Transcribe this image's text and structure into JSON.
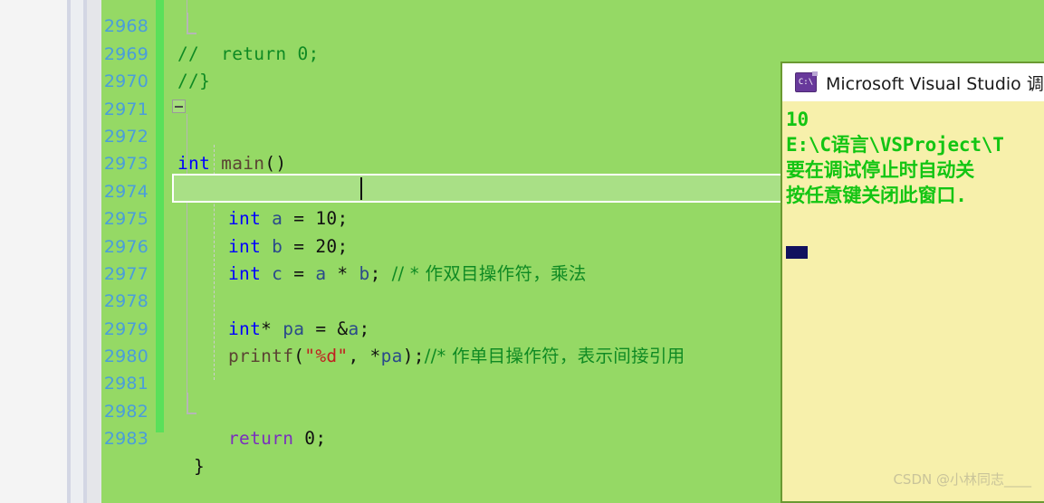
{
  "app": {
    "kind": "visual-studio-code-editor-with-debug-console"
  },
  "editor": {
    "background_color": "#95d965",
    "line_number_color": "#4a9ddb",
    "change_bar_color": "#5ae05a",
    "current_line": 2975,
    "lines": [
      {
        "number": "2968",
        "text": "//  return 0;"
      },
      {
        "number": "2969",
        "text": "//}"
      },
      {
        "number": "2970",
        "text": ""
      },
      {
        "number": "2971",
        "text": ""
      },
      {
        "number": "2972",
        "text": "int main()"
      },
      {
        "number": "2973",
        "text": "{"
      },
      {
        "number": "2974",
        "text": "    int a = 10;"
      },
      {
        "number": "2975",
        "text": "    int b = 20;"
      },
      {
        "number": "2976",
        "text": "    int c = a * b; // * 作双目操作符，乘法"
      },
      {
        "number": "2977",
        "text": ""
      },
      {
        "number": "2978",
        "text": "    int* pa = &a;"
      },
      {
        "number": "2979",
        "text": "    printf(\"%d\", *pa);//* 作单目操作符，表示间接引用"
      },
      {
        "number": "2980",
        "text": ""
      },
      {
        "number": "2981",
        "text": ""
      },
      {
        "number": "2982",
        "text": "    return 0;"
      },
      {
        "number": "2983",
        "text": "}"
      }
    ],
    "tokens": {
      "kw_int": "int",
      "kw_return": "return",
      "fn_main": "main",
      "fn_printf": "printf",
      "var_a": "a",
      "var_b": "b",
      "var_c": "c",
      "var_pa": "pa",
      "num_10": "10",
      "num_20": "20",
      "num_0": "0",
      "str_fmt": "\"%d\"",
      "comment_2968": "//  return 0;",
      "comment_2969": "//}",
      "comment_2976": "// * 作双目操作符，乘法",
      "comment_2979": "//* 作单目操作符，表示间接引用"
    }
  },
  "console": {
    "title": "Microsoft Visual Studio 调试控",
    "icon": "console-icon",
    "background_color": "#f7f0ab",
    "text_color": "#13c513",
    "border_color": "#6a9a32",
    "output_lines": [
      "10",
      "E:\\C语言\\VSProject\\T",
      "要在调试停止时自动关",
      "按任意键关闭此窗口."
    ]
  },
  "watermark": {
    "text": "CSDN @小林同志____"
  }
}
